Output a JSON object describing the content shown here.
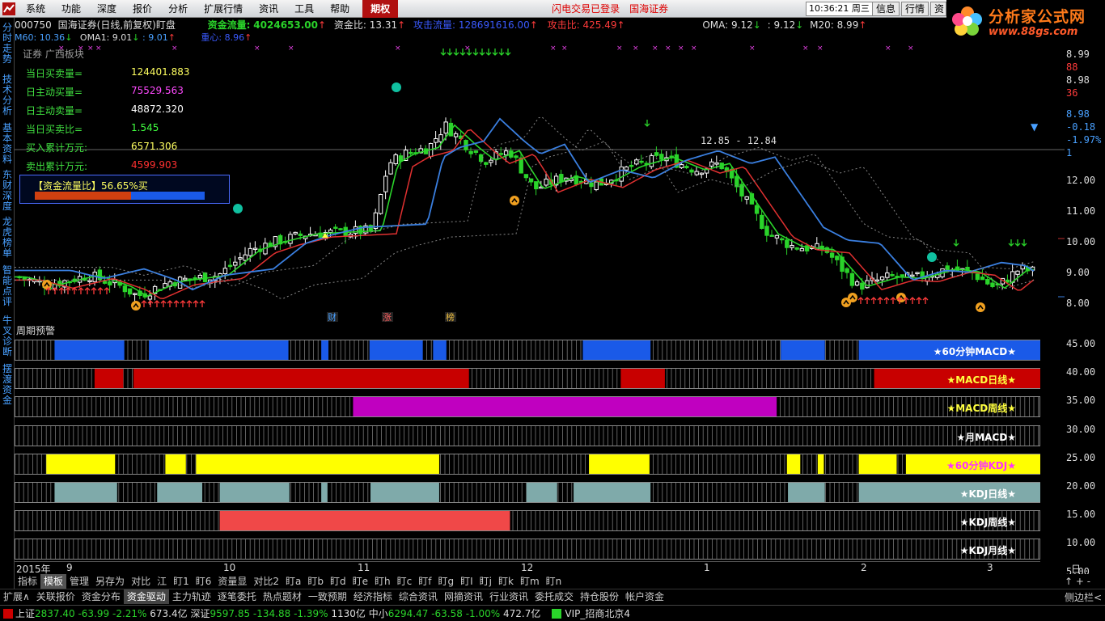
{
  "menubar": {
    "items": [
      "系统",
      "功能",
      "深度",
      "报价",
      "分析",
      "扩展行情",
      "资讯",
      "工具",
      "帮助"
    ],
    "active_item": "期权",
    "login_status": "闪电交易已登录",
    "broker": "国海证券",
    "clock": "10:36:21",
    "weekday": "周三",
    "buttons": [
      "信息",
      "行情",
      "资"
    ]
  },
  "brand": {
    "name": "分析家公式网",
    "url": "www.88gs.com"
  },
  "sidebar": {
    "tabs": [
      "分时走势",
      "技术分析",
      "基本资料",
      "东财深度",
      "龙虎榜单",
      "智能点评",
      "牛叉诊断",
      "摆渡资金"
    ]
  },
  "infobar": {
    "code": "000750",
    "name": "国海证券(日线,前复权)盯盘",
    "fund_flow_label": "资金流量:",
    "fund_flow_value": "4024653.00",
    "fund_ratio_label": "资金比:",
    "fund_ratio_value": "13.31",
    "attack_flow_label": "攻击流量:",
    "attack_flow_value": "128691616.00",
    "attack_ratio_label": "攻击比:",
    "attack_ratio_value": "425.49",
    "oma_label": "OMA:",
    "oma_value": "9.12",
    "oma_value2": ": 9.12",
    "m20_label": "M20:",
    "m20_value": "8.99"
  },
  "infobar2": {
    "m60": "M60: 10.36",
    "oma1": "OMA1: 9.01",
    "oma1b": ": 9.01",
    "center": "重心: 8.96"
  },
  "overlay": {
    "sector": "证券  广西板块",
    "rows": [
      {
        "label": "当日买卖量=",
        "value": "124401.883",
        "color": "#ffff60"
      },
      {
        "label": "日主动买量=",
        "value": "75529.563",
        "color": "#ff4aff"
      },
      {
        "label": "日主动卖量=",
        "value": "48872.320",
        "color": "#ffffff"
      },
      {
        "label": "当日买卖比=",
        "value": "1.545",
        "color": "#40ff40"
      },
      {
        "label": "买入累计万元:",
        "value": "6571.306",
        "color": "#ffff60"
      },
      {
        "label": "卖出累计万元:",
        "value": "4599.903",
        "color": "#ff3030"
      }
    ],
    "ratio_label": "【资金流量比】56.65%买",
    "buy_ratio": 0.5665
  },
  "chart_annotations": {
    "price_range_label": "12.85 - 12.84",
    "event_markers": [
      "财",
      "涨",
      "榜"
    ]
  },
  "axis": {
    "price_labels": [
      "8.99",
      "88",
      "8.98",
      "36",
      "8.98",
      "-0.18",
      "-1.97%",
      "1",
      "12.00",
      "11.00",
      "10.00",
      "9.00",
      "8.00"
    ],
    "panel_labels": [
      "45.00",
      "40.00",
      "35.00",
      "30.00",
      "25.00",
      "20.00",
      "15.00",
      "10.00",
      "5.00"
    ]
  },
  "cycle_panel": {
    "title": "周期预警",
    "rows": [
      {
        "label": "★60分钟MACD★",
        "color": "#1a5ae8",
        "label_color": "#ffffff",
        "segments": [
          [
            0.039,
            0.107
          ],
          [
            0.131,
            0.267
          ],
          [
            0.299,
            0.306
          ],
          [
            0.346,
            0.398
          ],
          [
            0.408,
            0.421
          ],
          [
            0.554,
            0.62
          ],
          [
            0.747,
            0.79
          ],
          [
            0.823,
            1.0
          ]
        ]
      },
      {
        "label": "★MACD日线★",
        "color": "#c80000",
        "label_color": "#ffff40",
        "segments": [
          [
            0.078,
            0.106
          ],
          [
            0.116,
            0.443
          ],
          [
            0.591,
            0.634
          ],
          [
            0.838,
            1.0
          ]
        ]
      },
      {
        "label": "★MACD周线★",
        "color": "#c000c0",
        "label_color": "#ffff40",
        "segments": [
          [
            0.33,
            0.743
          ]
        ]
      },
      {
        "label": "★月MACD★",
        "color": "#000000",
        "label_color": "#ffffff",
        "segments": []
      },
      {
        "label": "★60分钟KDJ★",
        "color": "#ffff00",
        "label_color": "#ff30ff",
        "segments": [
          [
            0.031,
            0.098
          ],
          [
            0.147,
            0.167
          ],
          [
            0.177,
            0.414
          ],
          [
            0.56,
            0.619
          ],
          [
            0.753,
            0.766
          ],
          [
            0.783,
            0.789
          ],
          [
            0.823,
            0.86
          ],
          [
            0.869,
            1.0
          ]
        ]
      },
      {
        "label": "★KDJ日线★",
        "color": "#7faaaa",
        "label_color": "#ffffff",
        "segments": [
          [
            0.039,
            0.1
          ],
          [
            0.139,
            0.183
          ],
          [
            0.2,
            0.268
          ],
          [
            0.299,
            0.305
          ],
          [
            0.347,
            0.414
          ],
          [
            0.499,
            0.529
          ],
          [
            0.545,
            0.62
          ],
          [
            0.754,
            0.79
          ],
          [
            0.823,
            1.0
          ]
        ]
      },
      {
        "label": "★KDJ周线★",
        "color": "#f04848",
        "label_color": "#ffffff",
        "segments": [
          [
            0.2,
            0.483
          ]
        ]
      },
      {
        "label": "★KDJ月线★",
        "color": "#000000",
        "label_color": "#ffffff",
        "segments": []
      }
    ]
  },
  "xaxis": {
    "labels": [
      "2015年",
      "9",
      "10",
      "11",
      "12",
      "1",
      "2",
      "3"
    ],
    "period": "日线"
  },
  "tabs1": {
    "items": [
      "指标",
      "模板",
      "管理",
      "另存为",
      "对比",
      "江",
      "盯1",
      "盯6",
      "资量显",
      "对比2",
      "盯a",
      "盯b",
      "盯d",
      "盯e",
      "盯h",
      "盯c",
      "盯f",
      "盯g",
      "盯I",
      "盯j",
      "盯k",
      "盯m",
      "盯n"
    ],
    "selected": "模板",
    "right_controls": "↑  +  -"
  },
  "tabs2": {
    "items": [
      "扩展∧",
      "关联报价",
      "资金分布",
      "资金驱动",
      "主力轨迹",
      "逐笔委托",
      "热点题材",
      "一致预期",
      "经济指标",
      "综合资讯",
      "网摘资讯",
      "行业资讯",
      "委托成交",
      "持仓股份",
      "帐户资金"
    ],
    "selected": "资金驱动",
    "right_label": "侧边栏<"
  },
  "statusbar": {
    "sh_name": "上证",
    "sh_price": "2837.40",
    "sh_chg": "-63.99",
    "sh_pct": "-2.21%",
    "sh_amt": "673.4亿",
    "sz_name": "深证",
    "sz_price": "9597.85",
    "sz_chg": "-134.88",
    "sz_pct": "-1.39%",
    "sz_amt": "1130亿",
    "zx_name": "中小",
    "zx_price": "6294.47",
    "zx_chg": "-63.58",
    "zx_pct": "-1.00%",
    "zx_amt": "472.7亿",
    "server": "VIP_招商北京4"
  },
  "colors": {
    "up": "#ff3b3b",
    "down": "#2ad42a",
    "ma_fast": "#2ad42a",
    "ma_mid": "#e03030",
    "ma_slow": "#3a7fe0"
  }
}
